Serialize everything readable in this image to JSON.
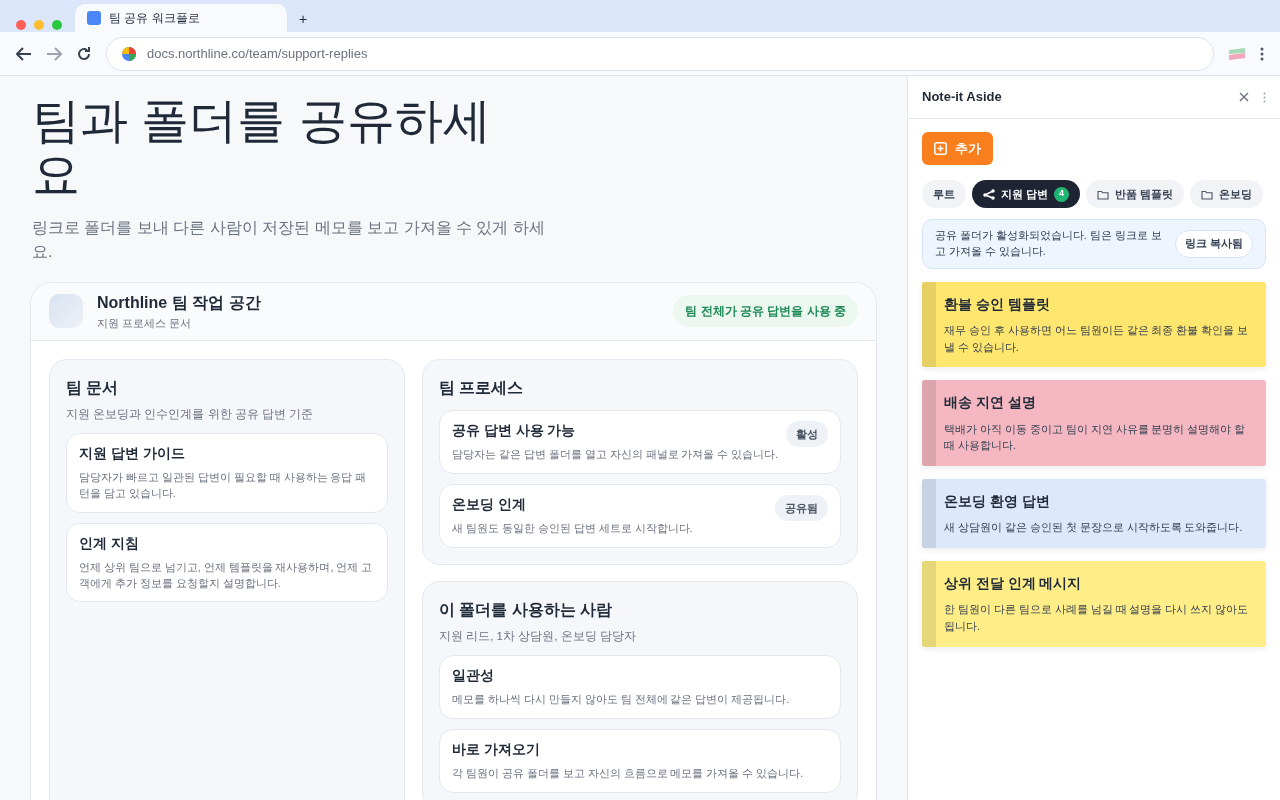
{
  "browser": {
    "tab_title": "팀 공유 워크플로",
    "new_tab": "+",
    "url": "docs.northline.co/team/support-replies"
  },
  "page": {
    "title": "팀과 폴더를 공유하세요",
    "subtitle": "링크로 폴더를 보내 다른 사람이 저장된 메모를 보고 가져올 수 있게 하세요.",
    "workspace": {
      "name": "Northline 팀 작업 공간",
      "subtitle": "지원 프로세스 문서",
      "status_badge": "팀 전체가 공유 답변을 사용 중",
      "columns": [
        [
          {
            "title": "팀 문서",
            "description": "지원 온보딩과 인수인계를 위한 공유 답변 기준",
            "items": [
              {
                "title": "지원 답변 가이드",
                "text": "담당자가 빠르고 일관된 답변이 필요할 때 사용하는 응답 패턴을 담고 있습니다."
              },
              {
                "title": "인계 지침",
                "text": "언제 상위 팀으로 넘기고, 언제 템플릿을 재사용하며, 언제 고객에게 추가 정보를 요청할지 설명합니다."
              }
            ]
          }
        ],
        [
          {
            "title": "팀 프로세스",
            "items": [
              {
                "title": "공유 답변 사용 가능",
                "text": "담당자는 같은 답변 폴더를 열고 자신의 패널로 가져올 수 있습니다.",
                "badge": "활성"
              },
              {
                "title": "온보딩 인계",
                "text": "새 팀원도 동일한 승인된 답변 세트로 시작합니다.",
                "badge": "공유됨"
              }
            ]
          },
          {
            "title": "이 폴더를 사용하는 사람",
            "description": "지원 리드, 1차 상담원, 온보딩 담당자",
            "items": [
              {
                "title": "일관성",
                "text": "메모를 하나씩 다시 만들지 않아도 팀 전체에 같은 답변이 제공됩니다."
              },
              {
                "title": "바로 가져오기",
                "text": "각 팀원이 공유 폴더를 보고 자신의 흐름으로 메모를 가져올 수 있습니다."
              }
            ]
          }
        ]
      ]
    }
  },
  "sidebar": {
    "title": "Note-it Aside",
    "add_button": "추가",
    "folders": [
      {
        "label": "루트",
        "kind": "plain",
        "selected": false
      },
      {
        "label": "지원 답변",
        "kind": "shared",
        "selected": true,
        "count": "4"
      },
      {
        "label": "반품 템플릿",
        "kind": "folder",
        "selected": false
      },
      {
        "label": "온보딩",
        "kind": "folder",
        "selected": false
      }
    ],
    "notice": {
      "text": "공유 폴더가 활성화되었습니다. 팀은 링크로 보고 가져올 수 있습니다.",
      "button": "링크 복사됨"
    },
    "notes": [
      {
        "title": "환불 승인 템플릿",
        "text": "재무 승인 후 사용하면 어느 팀원이든 같은 최종 환불 확인을 보낼 수 있습니다.",
        "color": "#ffe66e"
      },
      {
        "title": "배송 지연 설명",
        "text": "택배가 아직 이동 중이고 팀이 지연 사유를 분명히 설명해야 할 때 사용합니다.",
        "color": "#f5b8c2"
      },
      {
        "title": "온보딩 환영 답변",
        "text": "새 상담원이 같은 승인된 첫 문장으로 시작하도록 도와줍니다.",
        "color": "#dde8fd"
      },
      {
        "title": "상위 전달 인계 메시지",
        "text": "한 팀원이 다른 팀으로 사례를 넘길 때 설명을 다시 쓰지 않아도 됩니다.",
        "color": "#ffee88"
      }
    ]
  }
}
